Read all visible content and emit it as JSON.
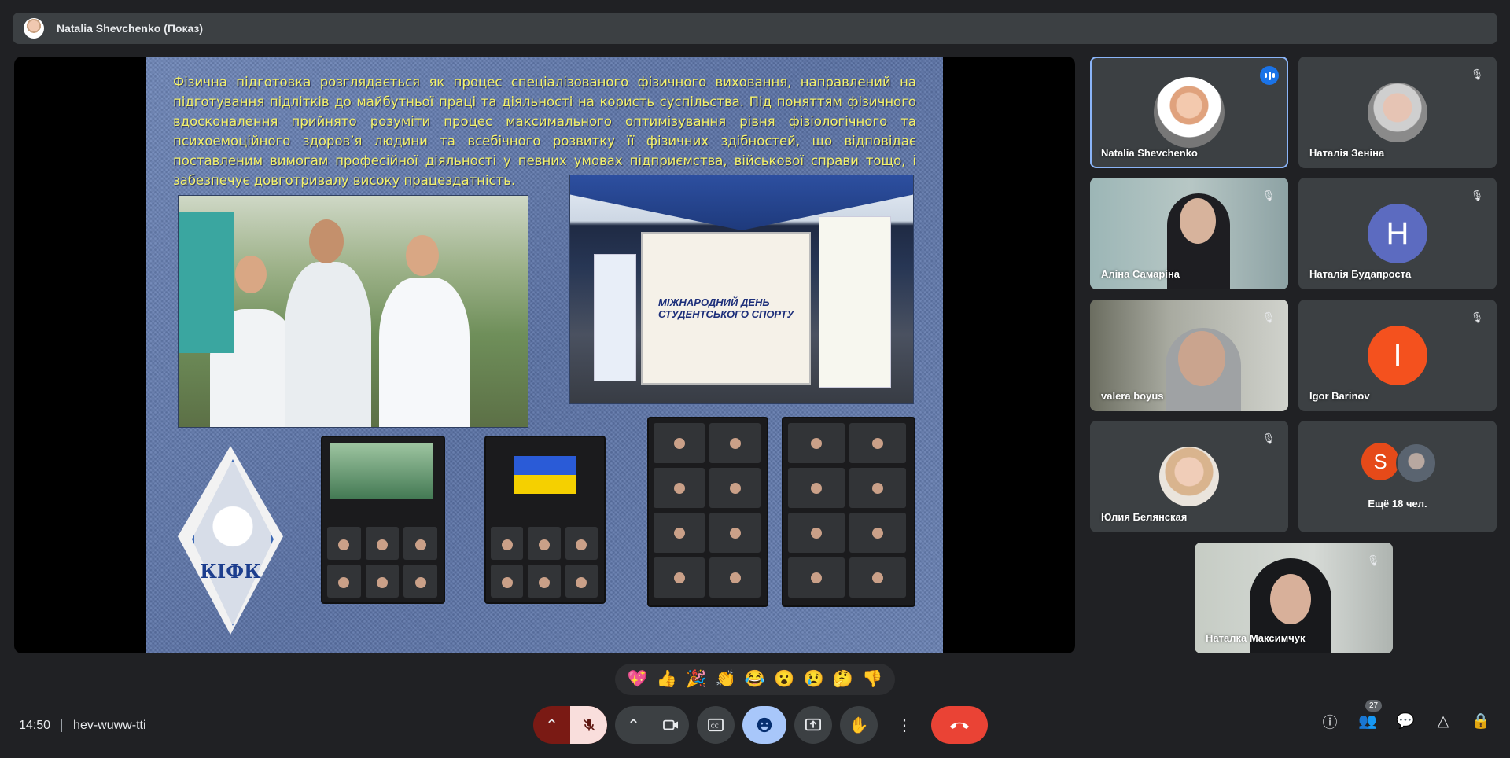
{
  "header": {
    "presenter_title": "Natalia Shevchenko (Показ)"
  },
  "slide": {
    "text": "Фізична підготовка розглядається як процес спеціалізованого фізичного виховання, направлений на підготування підлітків до майбутньої праці та діяльності на користь суспільства. Під поняттям фізичного вдосконалення прийнято розуміти процес максимального оптимізування рівня фізіологічного та психоемоційного здоров’я людини та всебічного розвитку її фізичних здібностей, що відповідає поставленим вимогам професійної діяльності у певних умовах підприємства, військової справи тощо, і забезпечує довготривалу високу працездатність.",
    "stage_banner": "МІЖНАРОДНИЙ ДЕНЬ СТУДЕНТСЬКОГО СПОРТУ",
    "emblem_text": "КІФК"
  },
  "participants": [
    {
      "name": "Natalia Shevchenko",
      "speaking": true
    },
    {
      "name": "Наталія Зеніна",
      "muted": true
    },
    {
      "name": "Аліна Самаріна",
      "muted": true
    },
    {
      "name": "Наталія Будапроста",
      "muted": true,
      "initial": "Н",
      "color": "#5c6bc0"
    },
    {
      "name": "valera boyus",
      "muted": true
    },
    {
      "name": "Igor Barinov",
      "muted": true,
      "initial": "I",
      "color": "#f4511e"
    },
    {
      "name": "Юлия Белянская",
      "muted": true
    },
    {
      "name": "Ещё 18 чел.",
      "initial": "S",
      "color": "#e64a19"
    },
    {
      "name": "Наталка Максимчук",
      "muted": true
    }
  ],
  "reactions": [
    "💖",
    "👍",
    "🎉",
    "👏",
    "😂",
    "😮",
    "😢",
    "🤔",
    "👎"
  ],
  "footer": {
    "time": "14:50",
    "meeting_code": "hev-wuww-tti",
    "people_count": "27"
  },
  "icons": {
    "mic": "mic-off-icon",
    "camera": "camera-icon",
    "captions": "captions-icon",
    "emoji": "emoji-icon",
    "present": "present-icon",
    "hand": "raise-hand-icon",
    "more": "more-vert-icon",
    "end": "end-call-icon"
  },
  "colors": {
    "accent": "#8ab4f8",
    "end_call": "#ea4335",
    "slide_text": "#f4f26a"
  }
}
